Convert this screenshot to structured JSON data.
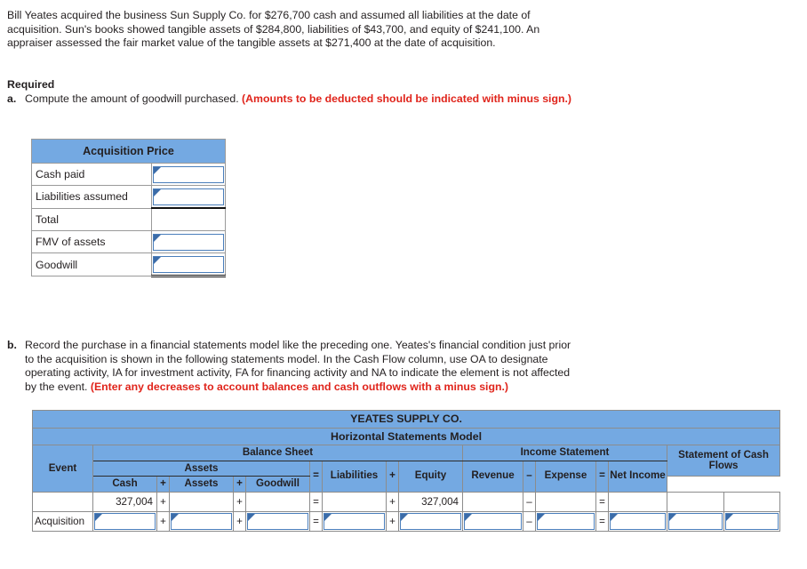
{
  "problem": {
    "paragraph": "Bill Yeates acquired the business Sun Supply Co. for $276,700 cash and assumed all liabilities at the date of acquisition. Sun's books showed tangible assets of $284,800, liabilities of $43,700, and equity of $241,100. An appraiser assessed the fair market value of the tangible assets at $271,400 at the date of acquisition.",
    "required_heading": "Required",
    "part_a": {
      "marker": "a.",
      "text": "Compute the amount of goodwill purchased. ",
      "emphasis": "(Amounts to be deducted should be indicated with minus sign.)"
    },
    "part_b": {
      "marker": "b.",
      "text": "Record the purchase in a financial statements model like the preceding one. Yeates's financial condition just prior to the acquisition is shown in the following statements model. In the Cash Flow column, use OA to designate operating activity, IA for investment activity, FA for financing activity and NA to indicate the element is not affected by the event. ",
      "emphasis": "(Enter any decreases to account balances and cash outflows with a minus sign.)"
    }
  },
  "acquisition_table": {
    "header": "Acquisition Price",
    "rows": [
      {
        "label": "Cash paid",
        "value": "",
        "input": true,
        "rule": "none"
      },
      {
        "label": "Liabilities assumed",
        "value": "",
        "input": true,
        "rule": "single"
      },
      {
        "label": "Total",
        "value": "",
        "input": false,
        "rule": "none"
      },
      {
        "label": "FMV of assets",
        "value": "",
        "input": true,
        "rule": "none"
      },
      {
        "label": "Goodwill",
        "value": "",
        "input": true,
        "rule": "double"
      }
    ]
  },
  "statements_model": {
    "company": "YEATES SUPPLY CO.",
    "subtitle": "Horizontal Statements Model",
    "groups": {
      "balance_sheet": "Balance Sheet",
      "assets": "Assets",
      "income_statement": "Income Statement",
      "cash_flows": "Statement of Cash Flows"
    },
    "columns": {
      "event": "Event",
      "cash": "Cash",
      "assets": "Assets",
      "goodwill": "Goodwill",
      "liabilities": "Liabilities",
      "equity": "Equity",
      "revenue": "Revenue",
      "expense": "Expense",
      "net_income": "Net Income"
    },
    "operators": {
      "plus": "+",
      "equals": "=",
      "minus": "–"
    },
    "rows": [
      {
        "event": "",
        "input_row": false,
        "cash": "327,004",
        "assets": "",
        "goodwill": "",
        "liabilities": "",
        "equity": "327,004",
        "revenue": "",
        "expense": "",
        "net_income": "",
        "cash_flow_1": "",
        "cash_flow_2": ""
      },
      {
        "event": "Acquisition",
        "input_row": true,
        "cash": "",
        "assets": "",
        "goodwill": "",
        "liabilities": "",
        "equity": "",
        "revenue": "",
        "expense": "",
        "net_income": "",
        "cash_flow_1": "",
        "cash_flow_2": ""
      }
    ]
  }
}
